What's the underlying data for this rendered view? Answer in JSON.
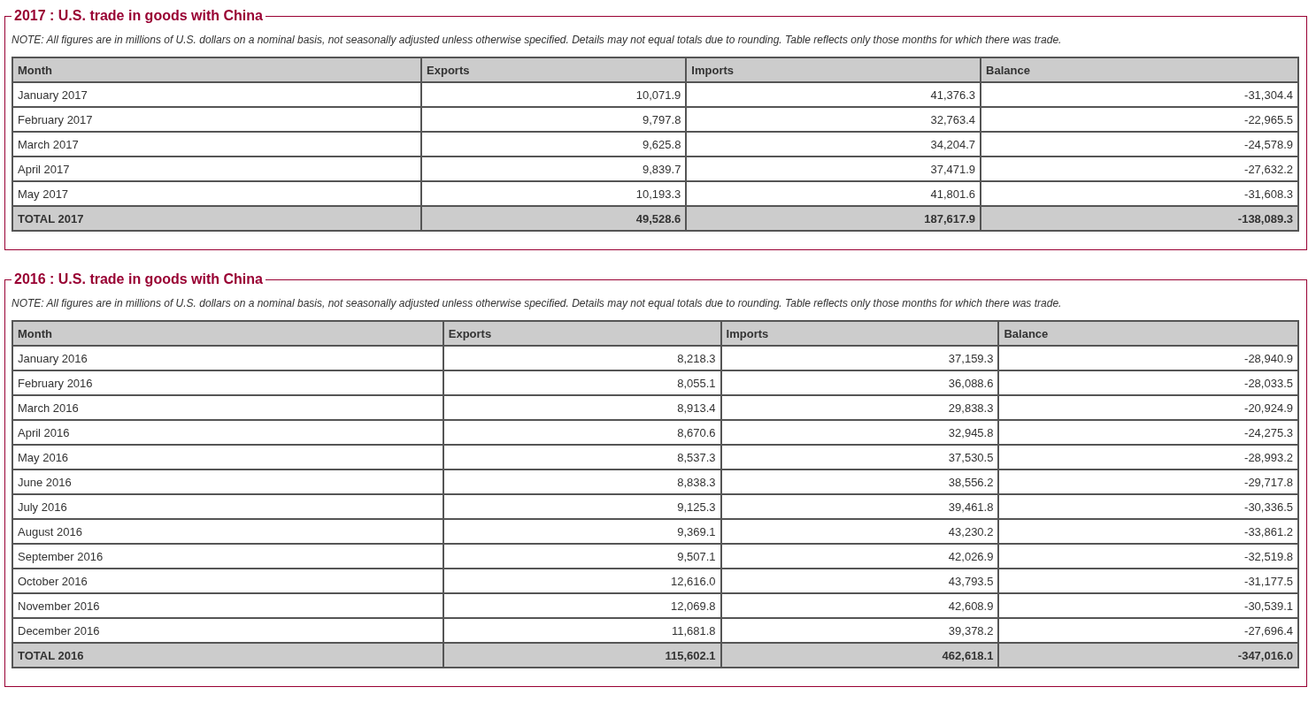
{
  "sections": [
    {
      "legend": "2017 : U.S. trade in goods with China",
      "note": "NOTE: All figures are in millions of U.S. dollars on a nominal basis, not seasonally adjusted unless otherwise specified. Details may not equal totals due to rounding. Table reflects only those months for which there was trade.",
      "columns": [
        "Month",
        "Exports",
        "Imports",
        "Balance"
      ],
      "rows": [
        {
          "kind": "month",
          "cells": [
            "January 2017",
            "10,071.9",
            "41,376.3",
            "-31,304.4"
          ]
        },
        {
          "kind": "month",
          "cells": [
            "February 2017",
            "9,797.8",
            "32,763.4",
            "-22,965.5"
          ]
        },
        {
          "kind": "month",
          "cells": [
            "March 2017",
            "9,625.8",
            "34,204.7",
            "-24,578.9"
          ]
        },
        {
          "kind": "month",
          "cells": [
            "April 2017",
            "9,839.7",
            "37,471.9",
            "-27,632.2"
          ]
        },
        {
          "kind": "month",
          "cells": [
            "May 2017",
            "10,193.3",
            "41,801.6",
            "-31,608.3"
          ]
        },
        {
          "kind": "total",
          "cells": [
            "TOTAL 2017",
            "49,528.6",
            "187,617.9",
            "-138,089.3"
          ]
        }
      ]
    },
    {
      "legend": "2016 : U.S. trade in goods with China",
      "note": "NOTE: All figures are in millions of U.S. dollars on a nominal basis, not seasonally adjusted unless otherwise specified. Details may not equal totals due to rounding. Table reflects only those months for which there was trade.",
      "columns": [
        "Month",
        "Exports",
        "Imports",
        "Balance"
      ],
      "rows": [
        {
          "kind": "month",
          "cells": [
            "January 2016",
            "8,218.3",
            "37,159.3",
            "-28,940.9"
          ]
        },
        {
          "kind": "month",
          "cells": [
            "February 2016",
            "8,055.1",
            "36,088.6",
            "-28,033.5"
          ]
        },
        {
          "kind": "month",
          "cells": [
            "March 2016",
            "8,913.4",
            "29,838.3",
            "-20,924.9"
          ]
        },
        {
          "kind": "month",
          "cells": [
            "April 2016",
            "8,670.6",
            "32,945.8",
            "-24,275.3"
          ]
        },
        {
          "kind": "month",
          "cells": [
            "May 2016",
            "8,537.3",
            "37,530.5",
            "-28,993.2"
          ]
        },
        {
          "kind": "month",
          "cells": [
            "June 2016",
            "8,838.3",
            "38,556.2",
            "-29,717.8"
          ]
        },
        {
          "kind": "month",
          "cells": [
            "July 2016",
            "9,125.3",
            "39,461.8",
            "-30,336.5"
          ]
        },
        {
          "kind": "month",
          "cells": [
            "August 2016",
            "9,369.1",
            "43,230.2",
            "-33,861.2"
          ]
        },
        {
          "kind": "month",
          "cells": [
            "September 2016",
            "9,507.1",
            "42,026.9",
            "-32,519.8"
          ]
        },
        {
          "kind": "month",
          "cells": [
            "October 2016",
            "12,616.0",
            "43,793.5",
            "-31,177.5"
          ]
        },
        {
          "kind": "month",
          "cells": [
            "November 2016",
            "12,069.8",
            "42,608.9",
            "-30,539.1"
          ]
        },
        {
          "kind": "month",
          "cells": [
            "December 2016",
            "11,681.8",
            "39,378.2",
            "-27,696.4"
          ]
        },
        {
          "kind": "total",
          "cells": [
            "TOTAL 2016",
            "115,602.1",
            "462,618.1",
            "-347,016.0"
          ]
        }
      ]
    }
  ]
}
